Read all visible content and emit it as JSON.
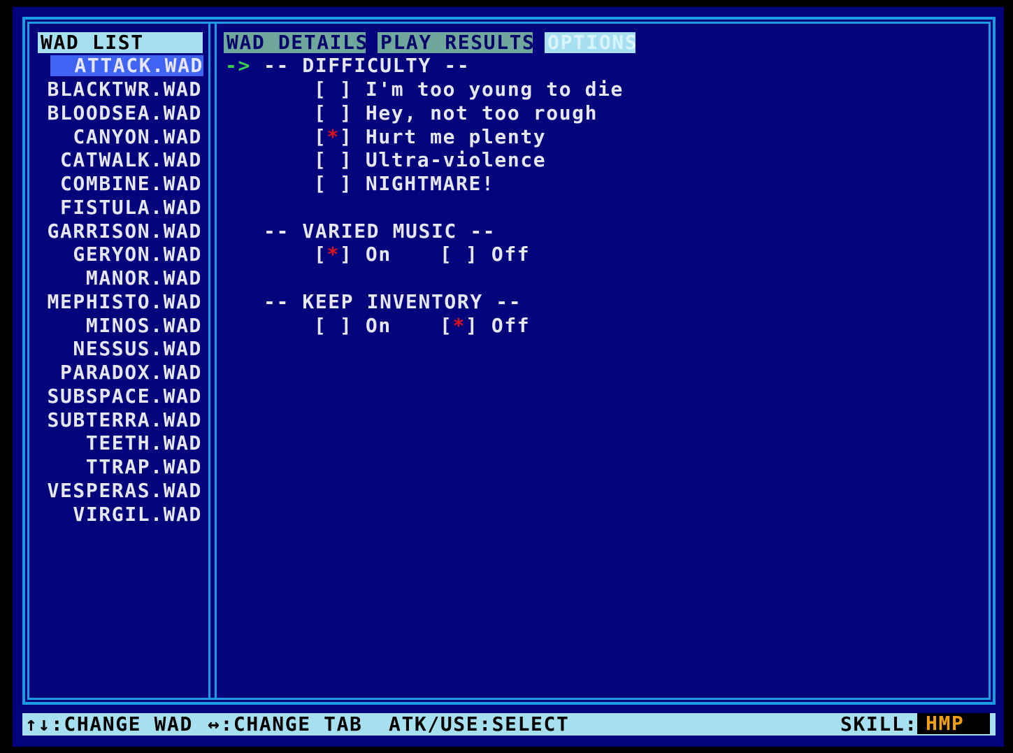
{
  "wad_list": {
    "header": "WAD LIST",
    "items": [
      "ATTACK.WAD",
      "BLACKTWR.WAD",
      "BLOODSEA.WAD",
      "CANYON.WAD",
      "CATWALK.WAD",
      "COMBINE.WAD",
      "FISTULA.WAD",
      "GARRISON.WAD",
      "GERYON.WAD",
      "MANOR.WAD",
      "MEPHISTO.WAD",
      "MINOS.WAD",
      "NESSUS.WAD",
      "PARADOX.WAD",
      "SUBSPACE.WAD",
      "SUBTERRA.WAD",
      "TEETH.WAD",
      "TTRAP.WAD",
      "VESPERAS.WAD",
      "VIRGIL.WAD"
    ],
    "selected_index": 0
  },
  "tabs": [
    "WAD DETAILS",
    "PLAY RESULTS",
    "OPTIONS"
  ],
  "active_tab": "OPTIONS",
  "options": {
    "cursor": "->",
    "difficulty": {
      "heading": "-- DIFFICULTY --",
      "choices": [
        {
          "label": "I'm too young to die",
          "mark": " "
        },
        {
          "label": "Hey, not too rough",
          "mark": " "
        },
        {
          "label": "Hurt me plenty",
          "mark": "*"
        },
        {
          "label": "Ultra-violence",
          "mark": " "
        },
        {
          "label": "NIGHTMARE!",
          "mark": " "
        }
      ]
    },
    "varied_music": {
      "heading": "-- VARIED MUSIC --",
      "on_label": "On",
      "on_mark": "*",
      "off_label": "Off",
      "off_mark": " "
    },
    "keep_inventory": {
      "heading": "-- KEEP INVENTORY --",
      "on_label": "On",
      "on_mark": " ",
      "off_label": "Off",
      "off_mark": "*"
    }
  },
  "status_bar": {
    "change_wad": "↑↓:CHANGE WAD",
    "change_tab": "↔:CHANGE TAB",
    "select": "ATK/USE:SELECT",
    "skill_label": "SKILL:",
    "skill_value": "HMP"
  },
  "colors": {
    "background": "#03037c",
    "frame": "#1b9be0",
    "highlight": "#a6e0f0",
    "selected_item": "#3f63f3",
    "arrow": "#35d04b",
    "mark": "#e01020",
    "skill_value": "#f0a010"
  }
}
